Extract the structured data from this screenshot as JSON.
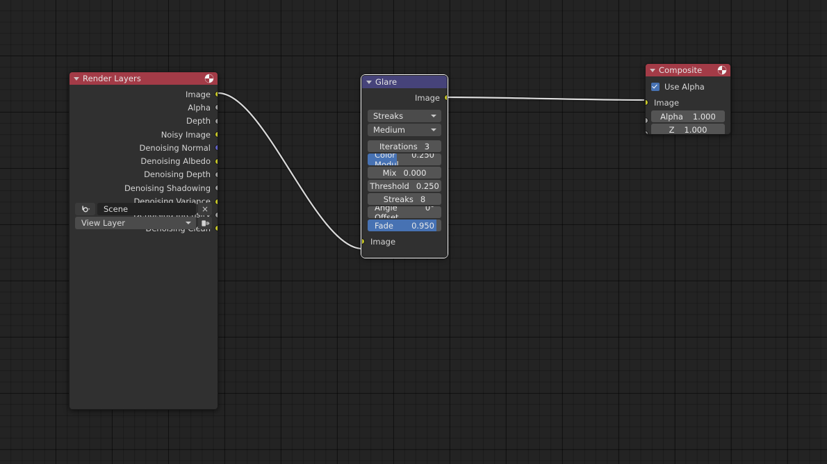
{
  "editor": {
    "name": "blender-compositor-node-editor",
    "background_color": "#232323",
    "grid_color": "#1a1a1a"
  },
  "nodes": {
    "render_layers": {
      "title": "Render Layers",
      "header_color": "#a33b47",
      "header_icon": "render-layers-icon",
      "collapse_icon": "collapse-triangle-icon",
      "outputs": [
        {
          "label": "Image",
          "socket": "image"
        },
        {
          "label": "Alpha",
          "socket": "value"
        },
        {
          "label": "Depth",
          "socket": "value"
        },
        {
          "label": "Noisy Image",
          "socket": "image"
        },
        {
          "label": "Denoising Normal",
          "socket": "vector"
        },
        {
          "label": "Denoising Albedo",
          "socket": "image"
        },
        {
          "label": "Denoising Depth",
          "socket": "value"
        },
        {
          "label": "Denoising Shadowing",
          "socket": "value"
        },
        {
          "label": "Denoising Variance",
          "socket": "image"
        },
        {
          "label": "Denoising Intensity",
          "socket": "value"
        },
        {
          "label": "Denoising Clean",
          "socket": "image"
        }
      ],
      "scene_row": {
        "icon": "scene-icon",
        "value": "Scene",
        "clear_label": "×"
      },
      "view_layer_row": {
        "value": "View Layer",
        "new_icon": "new-viewlayer-icon"
      }
    },
    "glare": {
      "title": "Glare",
      "header_color": "#46437a",
      "selected": true,
      "outputs": [
        {
          "label": "Image",
          "socket": "image"
        }
      ],
      "inputs": [
        {
          "label": "Image",
          "socket": "image"
        }
      ],
      "dropdowns": [
        {
          "name": "glare-type-dropdown",
          "value": "Streaks"
        },
        {
          "name": "quality-dropdown",
          "value": "Medium"
        }
      ],
      "properties": [
        {
          "name": "iterations",
          "label": "Iterations",
          "value": "3",
          "fill": 0,
          "centered": true
        },
        {
          "name": "color-modulation",
          "label": "Color Modul",
          "value": "0.250",
          "fill": 0.4,
          "centered": true
        },
        {
          "name": "mix",
          "label": "Mix",
          "value": "0.000",
          "fill": 0,
          "centered": true
        },
        {
          "name": "threshold",
          "label": "Threshold",
          "value": "0.250",
          "fill": 0,
          "centered": true
        },
        {
          "name": "streaks",
          "label": "Streaks",
          "value": "8",
          "fill": 0,
          "centered": true
        },
        {
          "name": "angle-offset",
          "label": "Angle Offset",
          "value": "0°",
          "fill": 0,
          "centered": true
        },
        {
          "name": "fade",
          "label": "Fade",
          "value": "0.950",
          "fill": 0.93,
          "centered": false
        }
      ]
    },
    "composite": {
      "title": "Composite",
      "header_color": "#a33b47",
      "header_icon": "composite-icon",
      "use_alpha": {
        "label": "Use Alpha",
        "checked": true
      },
      "inputs": [
        {
          "label": "Image",
          "socket": "image",
          "widget": false
        },
        {
          "label": "Alpha",
          "socket": "value",
          "widget": true,
          "value": "1.000"
        },
        {
          "label": "Z",
          "socket": "value",
          "widget": true,
          "value": "1.000"
        }
      ]
    }
  },
  "links": [
    {
      "name": "renderlayers-image-to-glare-image",
      "from": "render_layers.Image",
      "to": "glare.Image",
      "color": "#d8d8d8"
    },
    {
      "name": "glare-image-to-composite-image",
      "from": "glare.Image",
      "to": "composite.Image",
      "color": "#d8d8d8"
    }
  ]
}
